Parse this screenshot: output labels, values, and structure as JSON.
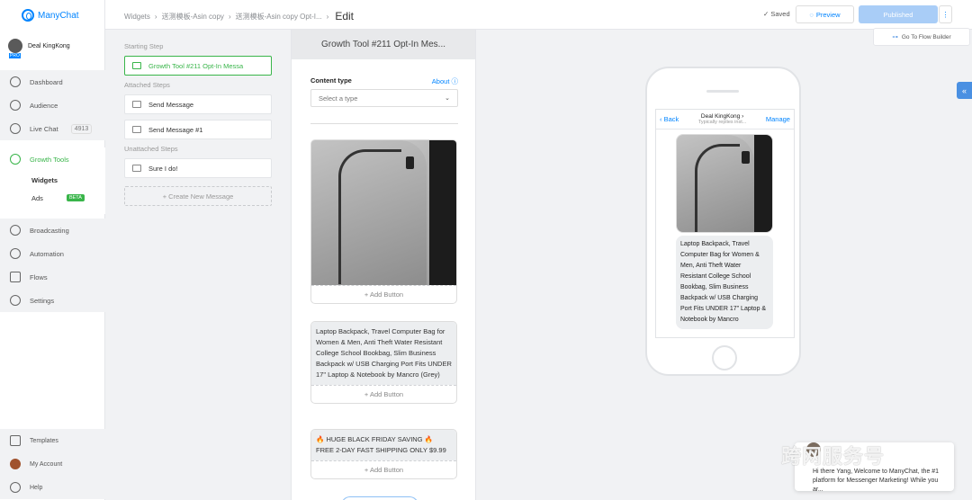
{
  "app": {
    "brand": "ManyChat"
  },
  "account": {
    "name": "Deal KingKong",
    "plan_badge": "PRO"
  },
  "nav": {
    "dashboard": "Dashboard",
    "audience": "Audience",
    "live_chat": "Live Chat",
    "live_chat_count": "4913",
    "growth_tools": "Growth Tools",
    "widgets": "Widgets",
    "ads": "Ads",
    "ads_badge": "BETA",
    "broadcasting": "Broadcasting",
    "automation": "Automation",
    "flows": "Flows",
    "settings": "Settings",
    "templates": "Templates",
    "my_account": "My Account",
    "help": "Help"
  },
  "breadcrumb": {
    "items": [
      "Widgets",
      "送测模板-Asin copy",
      "送测模板-Asin copy Opt-I..."
    ],
    "current": "Edit"
  },
  "toolbar": {
    "saved": "Saved",
    "preview": "Preview",
    "published": "Published",
    "more": "⋮",
    "flow_builder": "Go To Flow Builder"
  },
  "steps": {
    "starting_label": "Starting Step",
    "starting_step": "Growth Tool #211 Opt-In Messa",
    "attached_label": "Attached Steps",
    "attached": [
      "Send Message",
      "Send Message #1"
    ],
    "unattached_label": "Unattached Steps",
    "unattached": [
      "Sure I do!"
    ],
    "create_new": "+ Create New Message"
  },
  "editor": {
    "title": "Growth Tool #211 Opt-In Mes...",
    "content_type_label": "Content type",
    "about_link": "About",
    "select_placeholder": "Select a type",
    "card_description": "Laptop Backpack, Travel Computer Bag for Women & Men, Anti Theft Water Resistant College School Bookbag, Slim Business Backpack w/ USB Charging Port Fits UNDER 17\" Laptop & Notebook by Mancro (Grey)",
    "promo_line1": "HUGE BLACK FRIDAY SAVING",
    "promo_line2": "FREE 2-DAY FAST SHIPPING ONLY $9.99",
    "add_button": "+ Add Button"
  },
  "phone": {
    "back": "Back",
    "page_name": "Deal KingKong",
    "subtitle": "Typically replies inst...",
    "manage": "Manage",
    "message_text": "Laptop Backpack, Travel Computer Bag for Women & Men, Anti Theft Water Resistant College School Bookbag, Slim Business Backpack w/ USB Charging Port Fits UNDER 17\" Laptop & Notebook by Mancro"
  },
  "chat_popup": {
    "text": "Hi there Yang, Welcome to ManyChat, the #1 platform for Messenger Marketing! While you ar..."
  },
  "watermark": "跨网服务号",
  "colors": {
    "accent": "#0084ff",
    "growth_green": "#39b54a"
  }
}
